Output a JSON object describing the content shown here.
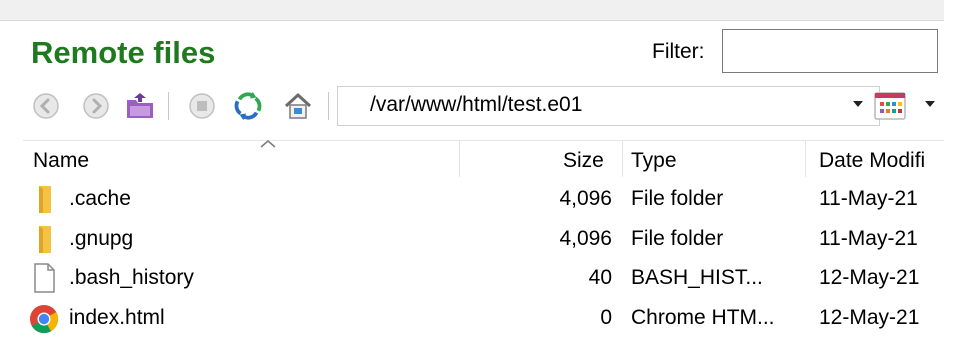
{
  "panel": {
    "title": "Remote files",
    "filter_label": "Filter:",
    "filter_value": ""
  },
  "toolbar": {
    "buttons": [
      {
        "icon": "back-icon"
      },
      {
        "icon": "forward-icon"
      },
      {
        "icon": "parent-folder-icon"
      },
      {
        "icon": "stop-icon"
      },
      {
        "icon": "refresh-icon"
      },
      {
        "icon": "home-icon"
      }
    ],
    "path": "/var/www/html/test.e01",
    "view_icon": "view-options-icon"
  },
  "table": {
    "headers": {
      "name": "Name",
      "size": "Size",
      "type": "Type",
      "date": "Date Modifi"
    },
    "rows": [
      {
        "name": ".cache",
        "size": "4,096",
        "type": "File folder",
        "date": "11-May-21",
        "icon": "folder-icon"
      },
      {
        "name": ".gnupg",
        "size": "4,096",
        "type": "File folder",
        "date": "11-May-21",
        "icon": "folder-icon"
      },
      {
        "name": ".bash_history",
        "size": "40",
        "type": "BASH_HIST...",
        "date": "12-May-21",
        "icon": "document-icon"
      },
      {
        "name": "index.html",
        "size": "0",
        "type": "Chrome HTM...",
        "date": "12-May-21",
        "icon": "chrome-icon"
      }
    ]
  },
  "colors": {
    "title": "#1f7a1f",
    "folder": "#f5c242",
    "refresh_green": "#2fa84f",
    "refresh_blue": "#2a6fbf"
  }
}
